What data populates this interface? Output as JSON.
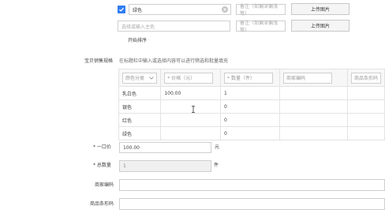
{
  "color_row": {
    "checked": true,
    "color_value": "绿色",
    "note_placeholder": "备注（如偏深偏浅等）",
    "upload_label": "上传图片"
  },
  "new_color_row": {
    "color_placeholder": "选择或输入主色",
    "note_placeholder": "备注（如偏深偏浅等）",
    "upload_label": "上传图片"
  },
  "sort_link": "开始排序",
  "sku_section": {
    "label": "宝贝销售规格",
    "hint": "在标题栏中输入或选择内容可以进行筛选和批量填充",
    "headers": {
      "color_category": "颜色分类",
      "price": "* 价格（元）",
      "quantity": "* 数量（件）",
      "merchant_code": "商家编码",
      "barcode": "商品条形码"
    },
    "rows": [
      {
        "color": "乳白色",
        "price": "100.00",
        "quantity": "1"
      },
      {
        "color": "银色",
        "price": "",
        "quantity": "0"
      },
      {
        "color": "红色",
        "price": "",
        "quantity": "0"
      },
      {
        "color": "绿色",
        "price": "",
        "quantity": "0"
      }
    ]
  },
  "fixed_price": {
    "label": "* 一口价",
    "value": "100.00",
    "unit": "元"
  },
  "total_quantity": {
    "label": "* 总数量",
    "value": "1",
    "unit": "件"
  },
  "merchant_code": {
    "label": "商家编码",
    "value": ""
  },
  "barcode": {
    "label": "商品条形码",
    "value": ""
  },
  "colors": {
    "accent": "#2f7cf6",
    "border": "#cfcfcf",
    "disabled_bg": "#f0f0f0"
  }
}
